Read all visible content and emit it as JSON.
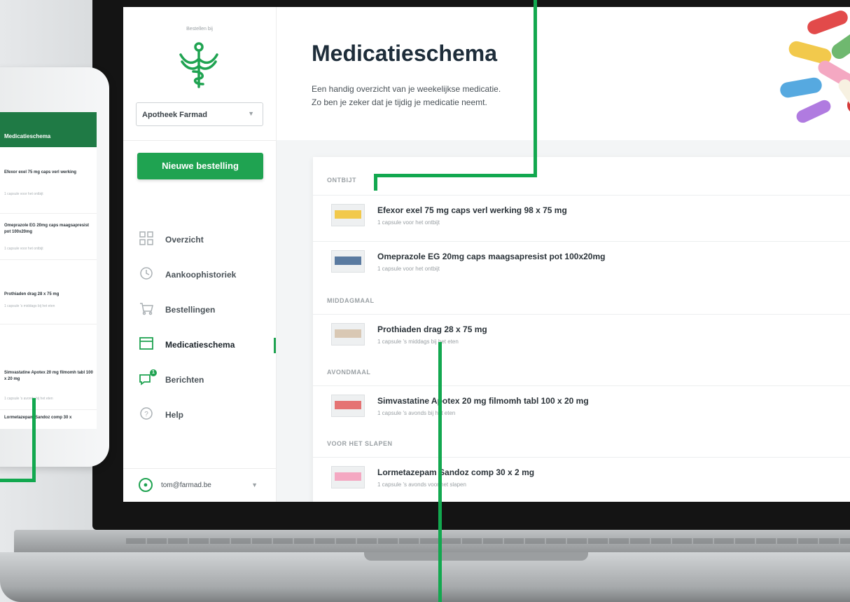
{
  "sidebar": {
    "brand_small": "Bestellen bij",
    "pharmacy": "Apotheek Farmad",
    "new_order": "Nieuwe bestelling",
    "items": [
      {
        "label": "Overzicht",
        "icon": "grid-icon",
        "active": false
      },
      {
        "label": "Aankoophistoriek",
        "icon": "history-icon",
        "active": false
      },
      {
        "label": "Bestellingen",
        "icon": "cart-icon",
        "active": false
      },
      {
        "label": "Medicatieschema",
        "icon": "calendar-icon",
        "active": true
      },
      {
        "label": "Berichten",
        "icon": "chat-icon",
        "active": false,
        "badge": "1"
      },
      {
        "label": "Help",
        "icon": "help-icon",
        "active": false
      }
    ],
    "user_email": "tom@farmad.be"
  },
  "header": {
    "title": "Medicatieschema",
    "subtitle_line1": "Een handig overzicht van je weekelijkse medicatie.",
    "subtitle_line2": "Zo ben je zeker dat je tijdig je medicatie neemt."
  },
  "schedule": {
    "sections": [
      {
        "title": "ONTBIJT",
        "items": [
          {
            "name": "Efexor exel 75 mg caps verl werking 98 x 75 mg",
            "dose": "1 capsule voor het ontbijt"
          },
          {
            "name": "Omeprazole EG 20mg caps maagsapresist pot 100x20mg",
            "dose": "1 capsule voor het ontbijt"
          }
        ]
      },
      {
        "title": "MIDDAGMAAL",
        "items": [
          {
            "name": "Prothiaden drag 28 x 75 mg",
            "dose": "1 capsule 's middags bij het eten"
          }
        ]
      },
      {
        "title": "AVONDMAAL",
        "items": [
          {
            "name": "Simvastatine Apotex 20 mg filmomh tabl 100 x 20 mg",
            "dose": "1 capsule 's avonds bij het eten"
          }
        ]
      },
      {
        "title": "VOOR HET SLAPEN",
        "items": [
          {
            "name": "Lormetazepam Sandoz comp 30 x 2 mg",
            "dose": "1 capsule 's avonds voor het slapen"
          }
        ]
      }
    ]
  },
  "phone": {
    "title": "Medicatieschema",
    "items": [
      {
        "name": "Efexor exel 75 mg caps verl werking",
        "dose": "1 capsule voor het ontbijt"
      },
      {
        "name": "Omeprazole EG 20mg caps maagsapresist pot 100x20mg",
        "dose": "1 capsule voor het ontbijt"
      },
      {
        "name": "Prothiaden drag 28 x 75 mg",
        "dose": "1 capsule 's middags bij het eten"
      },
      {
        "name": "Simvastatine Apotex 20 mg filmomh tabl 100 x 20 mg",
        "dose": "1 capsule 's avonds bij het eten"
      },
      {
        "name": "Lormetazepam Sandoz comp 30 x",
        "dose": ""
      }
    ]
  },
  "colors": {
    "accent": "#1fa351",
    "phone_header": "#1f7a45",
    "callout": "#12a84f",
    "title": "#1e2d3a"
  }
}
